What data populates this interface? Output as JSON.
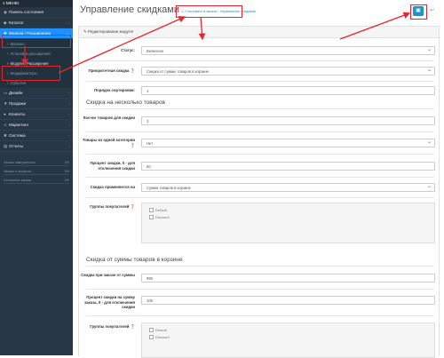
{
  "sidebar": {
    "menu_label": "МЕНЮ",
    "items": [
      {
        "label": "Панель состояния",
        "icon": "dashboard-icon",
        "icon_char": "◉",
        "chevron": ""
      },
      {
        "label": "Каталог",
        "icon": "tag-icon",
        "icon_char": "◆",
        "chevron": "›"
      },
      {
        "label": "Модули / Расширения",
        "icon": "puzzle-icon",
        "icon_char": "✚",
        "chevron": "⌄"
      }
    ],
    "sub_items": [
      {
        "label": "Магазин"
      },
      {
        "label": "Установка расширений"
      },
      {
        "label": "Модули / Расширения"
      },
      {
        "label": "Модификаторы"
      },
      {
        "label": "События"
      }
    ],
    "items2": [
      {
        "label": "Дизайн",
        "icon": "monitor-icon",
        "icon_char": "▭",
        "chevron": "›"
      },
      {
        "label": "Продажи",
        "icon": "cart-icon",
        "icon_char": "▼",
        "chevron": "›"
      },
      {
        "label": "Клиенты",
        "icon": "user-icon",
        "icon_char": "●",
        "chevron": "›"
      },
      {
        "label": "Маркетинг",
        "icon": "share-icon",
        "icon_char": "≺",
        "chevron": "›"
      },
      {
        "label": "Система",
        "icon": "gear-icon",
        "icon_char": "✱",
        "chevron": "›"
      },
      {
        "label": "Отчеты",
        "icon": "chart-icon",
        "icon_char": "▤",
        "chevron": "›"
      }
    ],
    "stats": [
      {
        "label": "Заказы завершенные",
        "value": "0%",
        "fraction": 0
      },
      {
        "label": "Заказы в процессе",
        "value": "0%",
        "fraction": 0
      },
      {
        "label": "Остальные заказы",
        "value": "0%",
        "fraction": 0
      }
    ]
  },
  "header": {
    "title": "Управление скидками",
    "breadcrumb_home": "⌂",
    "breadcrumb": [
      "Учитывать в заказе",
      "Управление скидками"
    ],
    "breadcrumb_sep": "/"
  },
  "panel": {
    "head": "✎ Редактирование модуля",
    "status": {
      "label": "Статус:",
      "value": "Включено"
    },
    "priority": {
      "label": "Приоритетная скидка",
      "value": "Скидка от суммы товаров в корзине"
    },
    "sort": {
      "label": "Порядок сортировки:",
      "value": "1"
    },
    "section1": "Скидка на несколько товаров",
    "qty": {
      "label": "Кол-во товаров для скидки",
      "value": "3"
    },
    "same_cat": {
      "label": "Товары из одной категории",
      "value": "Нет"
    },
    "percent1": {
      "label": "Процент скидки, 0 - для отключения скидки",
      "value": "50"
    },
    "applies": {
      "label": "Скидка применяется на",
      "value": "Сумма товаров в корзине"
    },
    "groups1": {
      "label": "Группы покупателей",
      "options": [
        "Default",
        "Discount"
      ]
    },
    "section2": "Скидка от суммы товаров в корзине",
    "order_sum": {
      "label": "Скидка при заказе от суммы",
      "value": "990"
    },
    "percent2": {
      "label": "Процент скидки на сумму заказа, 0 - для отключения скидки",
      "value": "100"
    },
    "groups2": {
      "label": "Группы покупателей",
      "options": [
        "Default",
        "Discount"
      ]
    }
  },
  "colors": {
    "accent": "#1e91cf",
    "sidebar": "#273745",
    "highlight": "#e8242b"
  }
}
